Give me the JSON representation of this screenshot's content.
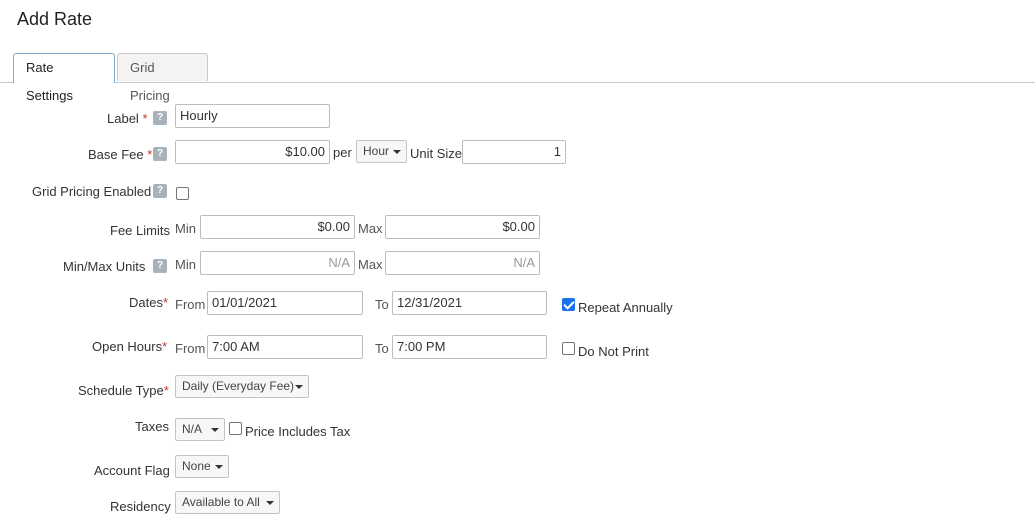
{
  "page": {
    "title": "Add Rate"
  },
  "tabs": [
    {
      "label": "Rate Settings"
    },
    {
      "label": "Grid Pricing"
    }
  ],
  "help_glyph": "?",
  "required_mark": "*",
  "form": {
    "label": {
      "label": "Label",
      "value": "Hourly"
    },
    "base_fee": {
      "label": "Base Fee",
      "value": "$10.00",
      "per": "per",
      "unit": "Hour",
      "unit_size_label": "Unit Size",
      "unit_size": "1"
    },
    "grid_pricing": {
      "label": "Grid Pricing Enabled",
      "checked": false
    },
    "fee_limits": {
      "label": "Fee Limits",
      "min_label": "Min",
      "min": "$0.00",
      "max_label": "Max",
      "max": "$0.00"
    },
    "minmax_units": {
      "label": "Min/Max Units",
      "min_label": "Min",
      "min_placeholder": "N/A",
      "max_label": "Max",
      "max_placeholder": "N/A"
    },
    "dates": {
      "label": "Dates",
      "from_label": "From",
      "from": "01/01/2021",
      "to_label": "To",
      "to": "12/31/2021",
      "repeat_label": "Repeat Annually",
      "repeat_checked": true
    },
    "open_hours": {
      "label": "Open Hours",
      "from_label": "From",
      "from": "7:00 AM",
      "to_label": "To",
      "to": "7:00 PM",
      "do_not_print_label": "Do Not Print",
      "do_not_print_checked": false
    },
    "schedule_type": {
      "label": "Schedule Type",
      "value": "Daily (Everyday Fee)"
    },
    "taxes": {
      "label": "Taxes",
      "value": "N/A",
      "price_includes_tax_label": "Price Includes Tax",
      "price_includes_tax_checked": false
    },
    "account_flag": {
      "label": "Account Flag",
      "value": "None"
    },
    "residency": {
      "label": "Residency",
      "value": "Available to All"
    }
  },
  "colors": {
    "tab_active_border": "#7fa9c9",
    "required": "#c0392b",
    "checkbox_checked": "#1a73e8",
    "help_bg": "#a9b2bb"
  }
}
